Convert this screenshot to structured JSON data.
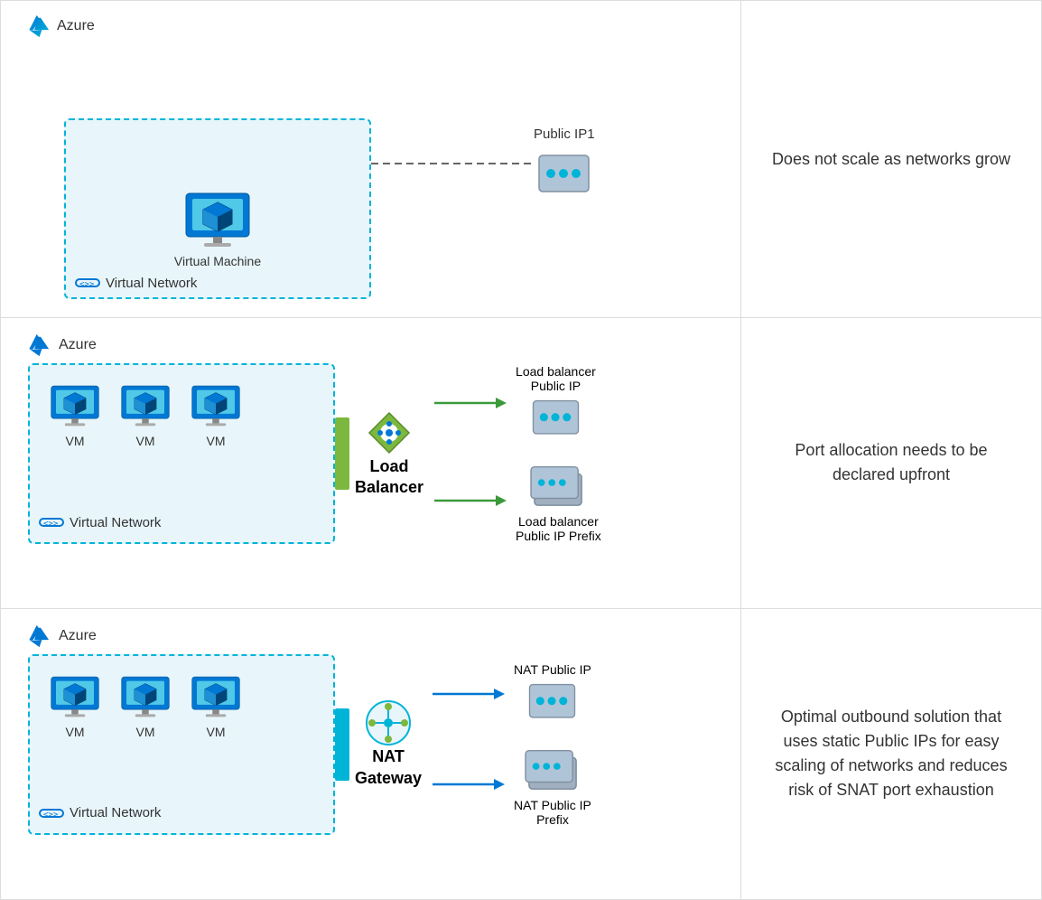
{
  "rows": [
    {
      "id": "row1",
      "azure_label": "Azure",
      "vnet_label": "Virtual Network",
      "diagram_elements": {
        "vm_label": "Virtual Machine",
        "public_ip_label": "Public IP1",
        "connection_type": "dashed"
      },
      "description": "Does not scale as networks grow"
    },
    {
      "id": "row2",
      "azure_label": "Azure",
      "vnet_label": "Virtual Network",
      "diagram_elements": {
        "vms": [
          "VM",
          "VM",
          "VM"
        ],
        "connector_label_line1": "Load",
        "connector_label_line2": "Balancer",
        "target1_label": "Load balancer\nPublic IP",
        "target2_label": "Load balancer\nPublic IP Prefix"
      },
      "description": "Port allocation needs to be declared upfront"
    },
    {
      "id": "row3",
      "azure_label": "Azure",
      "vnet_label": "Virtual Network",
      "diagram_elements": {
        "vms": [
          "VM",
          "VM",
          "VM"
        ],
        "connector_label_line1": "NAT",
        "connector_label_line2": "Gateway",
        "target1_label": "NAT Public IP",
        "target2_label": "NAT Public IP\nPrefix"
      },
      "description": "Optimal outbound solution that uses static Public IPs for easy scaling of networks and reduces risk of SNAT port exhaustion"
    }
  ]
}
